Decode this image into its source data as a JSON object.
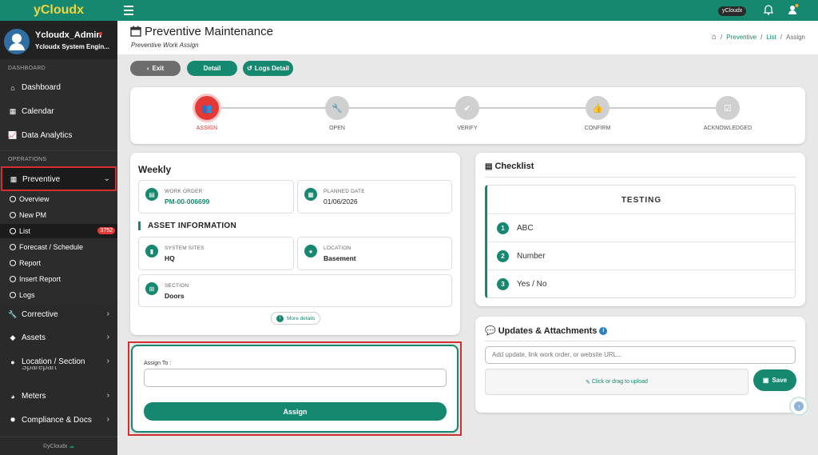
{
  "brand": "yCloudx",
  "topbar": {
    "user_chip": "yCloudx"
  },
  "profile": {
    "name": "Ycloudx_Admin",
    "role": "Ycloudx System Engin..."
  },
  "sidebar": {
    "section_dashboard": "DASHBOARD",
    "dashboard": "Dashboard",
    "calendar": "Calendar",
    "analytics": "Data Analytics",
    "section_operations": "OPERATIONS",
    "preventive": "Preventive",
    "subs": [
      "Overview",
      "New PM",
      "List",
      "Forecast / Schedule",
      "Report",
      "Insert Report",
      "Logs"
    ],
    "list_badge": "3752",
    "corrective": "Corrective",
    "assets": "Assets",
    "location": "Location / Section",
    "sparepart": "Sparepart",
    "meters": "Meters",
    "compliance": "Compliance & Docs",
    "footer": "©yCloudx"
  },
  "header": {
    "title": "Preventive Maintenance",
    "subtitle": "Preventive Work Assign"
  },
  "breadcrumb": {
    "b1": "Preventive",
    "b2": "List",
    "b3": "Assign",
    "sep": "/"
  },
  "buttons": {
    "exit": "Exit",
    "detail": "Detail",
    "logs": "Logs Detail"
  },
  "steps": [
    {
      "label": "ASSIGN"
    },
    {
      "label": "OPEN"
    },
    {
      "label": "VERIFY"
    },
    {
      "label": "CONFIRM"
    },
    {
      "label": "ACKNOWLEDGED"
    }
  ],
  "work": {
    "frequency": "Weekly",
    "wo_label": "WORK ORDER",
    "wo_value": "PM-00-006699",
    "pd_label": "PLANNED DATE",
    "pd_value": "01/06/2026",
    "asset_heading": "ASSET INFORMATION",
    "site_label": "SYSTEM SITES",
    "site_value": "HQ",
    "loc_label": "LOCATION",
    "loc_value": "Basement",
    "section_label": "SECTION",
    "section_value": "Doors",
    "more": "More details"
  },
  "assign": {
    "label": "Assign To :",
    "button": "Assign"
  },
  "checklist": {
    "title": "Checklist",
    "header": "TESTING",
    "items": [
      {
        "n": "1",
        "t": "ABC"
      },
      {
        "n": "2",
        "t": "Number"
      },
      {
        "n": "3",
        "t": "Yes / No"
      }
    ]
  },
  "updates": {
    "title": "Updates & Attachments",
    "placeholder": "Add update, link work order, or website URL...",
    "upload": "Click or drag to upload",
    "save": "Save"
  },
  "colors": {
    "primary": "#16886f",
    "accent_red": "#e53935",
    "highlight": "#d32f2f"
  }
}
